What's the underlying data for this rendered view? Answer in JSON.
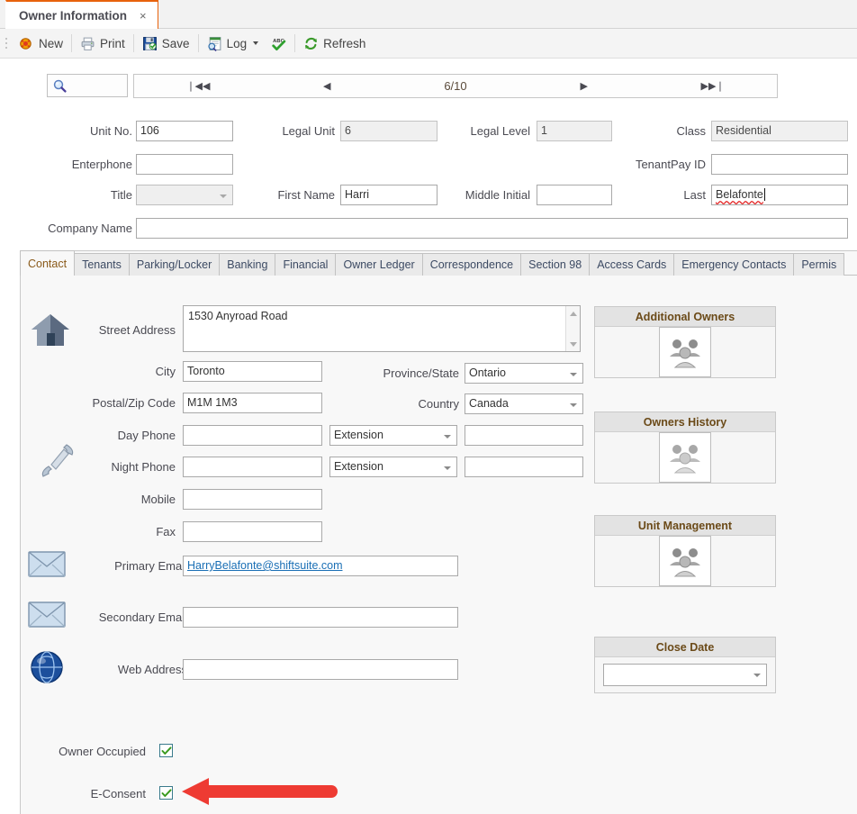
{
  "window": {
    "tab_title": "Owner Information",
    "close_glyph": "×"
  },
  "toolbar": {
    "items": [
      {
        "label": "New",
        "icon": "new-record-icon",
        "dropdown": false
      },
      {
        "label": "Print",
        "icon": "printer-icon",
        "dropdown": false
      },
      {
        "label": "Save",
        "icon": "save-disk-icon",
        "dropdown": false
      },
      {
        "label": "Log",
        "icon": "log-search-icon",
        "dropdown": true
      },
      {
        "label": "",
        "icon": "spellcheck-icon",
        "dropdown": false
      },
      {
        "label": "Refresh",
        "icon": "refresh-icon",
        "dropdown": false
      }
    ]
  },
  "navigator": {
    "search_icon": "magnifier-icon",
    "first": "❘◀◀",
    "prev": "◀",
    "position": "6/10",
    "next": "▶",
    "last": "▶▶❘"
  },
  "header_form": {
    "unit_no": {
      "label": "Unit No.",
      "value": "106",
      "readonly": false
    },
    "legal_unit": {
      "label": "Legal Unit",
      "value": "6",
      "readonly": true
    },
    "legal_level": {
      "label": "Legal Level",
      "value": "1",
      "readonly": true
    },
    "class": {
      "label": "Class",
      "value": "Residential",
      "readonly": true
    },
    "enterphone": {
      "label": "Enterphone",
      "value": "",
      "readonly": false
    },
    "tenantpay_id": {
      "label": "TenantPay ID",
      "value": "",
      "readonly": false
    },
    "title": {
      "label": "Title",
      "value": "",
      "readonly": true
    },
    "first_name": {
      "label": "First Name",
      "value": "Harri",
      "readonly": false
    },
    "middle_initial": {
      "label": "Middle Initial",
      "value": "",
      "readonly": false
    },
    "last_name": {
      "label": "Last",
      "value": "Belafonte",
      "readonly": false,
      "misspelled": true,
      "focused": true
    },
    "company_name": {
      "label": "Company Name",
      "value": "",
      "readonly": false
    }
  },
  "tabs": {
    "active": "Contact",
    "items": [
      "Contact",
      "Tenants",
      "Parking/Locker",
      "Banking",
      "Financial",
      "Owner Ledger",
      "Correspondence",
      "Section 98",
      "Access Cards",
      "Emergency Contacts",
      "Permis"
    ]
  },
  "contact": {
    "icons": {
      "address": "house-icon",
      "phone": "telephone-icon",
      "primary_email": "envelope-icon",
      "secondary_email": "envelope-icon",
      "web": "globe-icon"
    },
    "street_address": {
      "label": "Street Address",
      "value": "1530 Anyroad Road"
    },
    "city": {
      "label": "City",
      "value": "Toronto"
    },
    "province": {
      "label": "Province/State",
      "value": "Ontario"
    },
    "postal": {
      "label": "Postal/Zip Code",
      "value": "M1M 1M3"
    },
    "country": {
      "label": "Country",
      "value": "Canada"
    },
    "day_phone": {
      "label": "Day Phone",
      "value": ""
    },
    "day_ext": {
      "label": "Extension",
      "value": "Extension"
    },
    "day_ext_val": {
      "value": ""
    },
    "night_phone": {
      "label": "Night Phone",
      "value": ""
    },
    "night_ext": {
      "label": "Extension",
      "value": "Extension"
    },
    "night_ext_val": {
      "value": ""
    },
    "mobile": {
      "label": "Mobile",
      "value": ""
    },
    "fax": {
      "label": "Fax",
      "value": ""
    },
    "primary_email": {
      "label": "Primary Email",
      "value": "HarryBelafonte@shiftsuite.com",
      "is_link": true
    },
    "secondary_email": {
      "label": "Secondary Email",
      "value": ""
    },
    "web_address": {
      "label": "Web Address",
      "value": ""
    }
  },
  "side_panels": [
    {
      "title": "Additional Owners",
      "icon": "people-group-icon"
    },
    {
      "title": "Owners History",
      "icon": "people-group-icon"
    },
    {
      "title": "Unit Management",
      "icon": "people-group-icon"
    }
  ],
  "close_date": {
    "title": "Close Date",
    "value": ""
  },
  "checkboxes": [
    {
      "label": "Owner Occupied",
      "checked": true
    },
    {
      "label": "E-Consent",
      "checked": true
    }
  ],
  "annotation": {
    "arrow": "red-left-arrow",
    "color": "#ee3b33"
  },
  "colors": {
    "tab_accent": "#e8620c",
    "panel_header_text": "#6b4a18",
    "link": "#1a6fb5",
    "checkmark": "#3a9a1e",
    "spellcheck_underline": "#e32020"
  }
}
